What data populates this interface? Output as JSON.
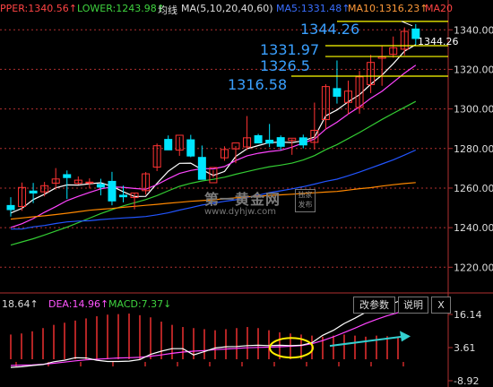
{
  "legend": {
    "upper": "PPER:1340.56↑",
    "lower": "LOWER:1243.98↑",
    "ma_label": "均线",
    "ma_periods": "MA(5,10,20,40,60)",
    "ma5": "MA5:1331.48↑",
    "ma10": "MA10:1316.23↑",
    "ma20": "MA20"
  },
  "macd_legend": {
    "dif": "18.64↑",
    "dea": "DEA:14.96↑",
    "macd": "MACD:7.37↓"
  },
  "controls": {
    "params_label": "改参数",
    "help_label": "说明",
    "close_label": "X"
  },
  "annotations": {
    "level1": "1344.26",
    "level2": "1331.97",
    "level3": "1326.5",
    "level4": "1316.58",
    "last_price": "1344.26"
  },
  "watermark": {
    "name": "第一黄金网",
    "url": "www.dyhjw.com",
    "stamp": "独家发布"
  },
  "axis": {
    "y_ticks": [
      "1340.00",
      "1320.00",
      "1300.00",
      "1280.00",
      "1260.00",
      "1240.00",
      "1220.00"
    ],
    "macd_ticks": [
      "16.14",
      "3.61",
      "-8.92"
    ]
  },
  "colors": {
    "up": "#ff3333",
    "down": "#00e5ff",
    "ma5": "#ffffff",
    "ma10": "#ff44ff",
    "ma20": "#33cc33",
    "ma40": "#2255ff",
    "ma60": "#ff8800",
    "level_line": "#ffff00",
    "annotation": "#3aa0ff",
    "grid": "#b03030"
  },
  "chart_data": [
    {
      "type": "candlestick",
      "ylim": [
        1207,
        1346
      ],
      "candles": [
        {
          "o": 1251.2,
          "h": 1255.4,
          "l": 1245.6,
          "c": 1249.1
        },
        {
          "o": 1250.7,
          "h": 1262.8,
          "l": 1248.5,
          "c": 1260.3
        },
        {
          "o": 1258.5,
          "h": 1262.6,
          "l": 1252.4,
          "c": 1257.5
        },
        {
          "o": 1258.1,
          "h": 1263.1,
          "l": 1255.8,
          "c": 1261.2
        },
        {
          "o": 1262.5,
          "h": 1270.1,
          "l": 1259.2,
          "c": 1264.6
        },
        {
          "o": 1266.8,
          "h": 1268.9,
          "l": 1254.5,
          "c": 1265.3
        },
        {
          "o": 1262.4,
          "h": 1265.9,
          "l": 1261.8,
          "c": 1264.0
        },
        {
          "o": 1262.6,
          "h": 1264.9,
          "l": 1259.8,
          "c": 1263.0
        },
        {
          "o": 1261.9,
          "h": 1264.7,
          "l": 1256.3,
          "c": 1260.5
        },
        {
          "o": 1263.4,
          "h": 1268.2,
          "l": 1251.3,
          "c": 1253.5
        },
        {
          "o": 1256.4,
          "h": 1261.2,
          "l": 1252.8,
          "c": 1255.6
        },
        {
          "o": 1255.2,
          "h": 1257.4,
          "l": 1249.3,
          "c": 1257.5
        },
        {
          "o": 1258.7,
          "h": 1268.1,
          "l": 1256.7,
          "c": 1267.2
        },
        {
          "o": 1270.6,
          "h": 1282.5,
          "l": 1268.6,
          "c": 1281.4
        },
        {
          "o": 1284.6,
          "h": 1286.6,
          "l": 1280.5,
          "c": 1279.3
        },
        {
          "o": 1279.2,
          "h": 1285.8,
          "l": 1276.3,
          "c": 1286.7
        },
        {
          "o": 1284.4,
          "h": 1286.9,
          "l": 1275.6,
          "c": 1276.2
        },
        {
          "o": 1275.5,
          "h": 1281.5,
          "l": 1265.2,
          "c": 1264.4
        },
        {
          "o": 1262.7,
          "h": 1269.1,
          "l": 1265.3,
          "c": 1270.4
        },
        {
          "o": 1275.3,
          "h": 1281.1,
          "l": 1273.8,
          "c": 1279.5
        },
        {
          "o": 1279.8,
          "h": 1281.2,
          "l": 1272.6,
          "c": 1282.8
        },
        {
          "o": 1280.8,
          "h": 1296.4,
          "l": 1279.2,
          "c": 1285.4
        },
        {
          "o": 1286.5,
          "h": 1287.4,
          "l": 1282.7,
          "c": 1282.8
        },
        {
          "o": 1284.2,
          "h": 1292.4,
          "l": 1280.7,
          "c": 1282.7
        },
        {
          "o": 1285.5,
          "h": 1286.6,
          "l": 1279.2,
          "c": 1281.1
        },
        {
          "o": 1284.1,
          "h": 1284.7,
          "l": 1276.8,
          "c": 1285.2
        },
        {
          "o": 1285.4,
          "h": 1287.0,
          "l": 1280.1,
          "c": 1281.8
        },
        {
          "o": 1283.1,
          "h": 1303.2,
          "l": 1279.5,
          "c": 1289.2
        },
        {
          "o": 1294.6,
          "h": 1312.5,
          "l": 1289.6,
          "c": 1311.3
        },
        {
          "o": 1310.3,
          "h": 1324.5,
          "l": 1302.7,
          "c": 1306.4
        },
        {
          "o": 1303.3,
          "h": 1314.3,
          "l": 1297.2,
          "c": 1309.0
        },
        {
          "o": 1300.8,
          "h": 1319.2,
          "l": 1297.6,
          "c": 1316.2
        },
        {
          "o": 1312.3,
          "h": 1327.3,
          "l": 1308.0,
          "c": 1323.5
        },
        {
          "o": 1325.6,
          "h": 1331.7,
          "l": 1311.7,
          "c": 1326.3
        },
        {
          "o": 1327.6,
          "h": 1336.6,
          "l": 1325.9,
          "c": 1330.9
        },
        {
          "o": 1330.2,
          "h": 1341.2,
          "l": 1327.1,
          "c": 1339.2
        },
        {
          "o": 1340.4,
          "h": 1342.9,
          "l": 1332.5,
          "c": 1335.6
        }
      ],
      "moving_averages": [
        {
          "name": "MA5",
          "values": [
            1247.4,
            1249.8,
            1254.2,
            1256.9,
            1260.1,
            1261.6,
            1261.5,
            1262.2,
            1262.7,
            1260.9,
            1258.1,
            1255.7,
            1255.8,
            1262.4,
            1268.5,
            1272.5,
            1272.6,
            1269.3,
            1266.4,
            1268.4,
            1276.0,
            1279.9,
            1281.5,
            1283.0,
            1283.2,
            1283.0,
            1283.9,
            1285.8,
            1296.5,
            1299.5,
            1303.6,
            1307.2,
            1312.5,
            1317.1,
            1322.8,
            1329.2,
            1332.5
          ]
        },
        {
          "name": "MA10",
          "values": [
            1240.1,
            1242.0,
            1244.6,
            1247.8,
            1250.6,
            1253.7,
            1255.8,
            1257.8,
            1259.6,
            1260.6,
            1260.4,
            1259.8,
            1259.4,
            1261.8,
            1264.7,
            1267.4,
            1268.9,
            1269.9,
            1269.7,
            1270.9,
            1273.9,
            1276.3,
            1277.6,
            1278.5,
            1279.1,
            1280.7,
            1282.8,
            1284.8,
            1289.8,
            1293.3,
            1297.4,
            1301.1,
            1305.4,
            1308.9,
            1313.5,
            1318.1,
            1322.1
          ]
        },
        {
          "name": "MA20",
          "values": [
            1231.2,
            1232.8,
            1234.4,
            1236.3,
            1238.3,
            1240.3,
            1242.5,
            1244.8,
            1247.1,
            1249.1,
            1251.0,
            1252.6,
            1254.2,
            1256.2,
            1258.6,
            1260.9,
            1262.4,
            1263.6,
            1264.4,
            1265.5,
            1267.0,
            1268.3,
            1269.6,
            1270.8,
            1271.6,
            1272.6,
            1274.2,
            1276.4,
            1279.4,
            1282.0,
            1285.0,
            1288.1,
            1291.4,
            1294.7,
            1297.8,
            1300.8,
            1303.8
          ]
        },
        {
          "name": "MA40",
          "values": [
            1239.3,
            1239.3,
            1240.4,
            1241.1,
            1242.1,
            1242.9,
            1243.3,
            1243.5,
            1244.1,
            1244.5,
            1244.9,
            1245.2,
            1245.6,
            1246.5,
            1247.5,
            1248.9,
            1250.1,
            1251.4,
            1252.3,
            1253.3,
            1254.1,
            1255.3,
            1256.4,
            1257.7,
            1258.6,
            1259.6,
            1260.7,
            1262.0,
            1263.4,
            1264.5,
            1266.2,
            1268.1,
            1270.1,
            1272.2,
            1274.3,
            1276.7,
            1279.2
          ]
        },
        {
          "name": "MA60",
          "values": [
            1244.3,
            1244.9,
            1245.5,
            1246.0,
            1246.6,
            1247.3,
            1248.0,
            1248.8,
            1249.3,
            1249.7,
            1250.3,
            1250.8,
            1251.3,
            1251.8,
            1252.3,
            1252.8,
            1253.3,
            1253.7,
            1254.1,
            1254.6,
            1255.1,
            1255.6,
            1255.9,
            1256.3,
            1256.6,
            1256.9,
            1257.3,
            1257.6,
            1258.0,
            1258.3,
            1259.0,
            1259.7,
            1260.2,
            1261.0,
            1261.7,
            1262.3,
            1262.8
          ]
        }
      ],
      "levels": [
        1344.26,
        1331.97,
        1326.5,
        1316.58
      ]
    },
    {
      "type": "macd",
      "ylim": [
        -8.92,
        16.14
      ],
      "dif": [
        -2.6,
        -2.4,
        -2.0,
        -1.7,
        -0.8,
        -0.3,
        0.5,
        0.4,
        -0.3,
        -0.7,
        -0.7,
        -0.6,
        -0.1,
        1.6,
        2.6,
        3.4,
        3.4,
        1.4,
        2.5,
        3.6,
        4.0,
        4.1,
        4.4,
        4.5,
        4.4,
        4.5,
        4.4,
        4.5,
        5.3,
        7.7,
        9.3,
        11.5,
        13.2,
        15.1,
        16.1,
        17.2,
        18.6
      ],
      "dea": [
        -2.0,
        -1.9,
        -1.8,
        -1.6,
        -1.3,
        -0.9,
        -0.5,
        -0.2,
        0.0,
        0.2,
        0.4,
        0.5,
        0.6,
        1.0,
        1.4,
        1.9,
        2.3,
        2.6,
        2.8,
        3.1,
        3.3,
        3.5,
        3.7,
        3.8,
        3.9,
        4.0,
        4.2,
        4.4,
        5.0,
        6.0,
        7.2,
        8.6,
        10.0,
        11.5,
        12.8,
        14.0,
        15.0
      ],
      "macd": [
        -0.6,
        -0.8,
        -1.2,
        -1.8,
        -2.4,
        -2.8,
        -3.2,
        -3.6,
        -4.0,
        -4.3,
        -4.4,
        -4.5,
        -4.2,
        -3.8,
        -3.0,
        -2.4,
        -2.0,
        -1.8,
        -1.6,
        -1.4,
        -1.6,
        -1.8,
        -2.0,
        -1.8,
        -1.4,
        -1.0,
        -0.8,
        -0.6,
        -0.4,
        -0.2,
        -0.4,
        -0.6,
        -0.4,
        -0.2,
        -0.4,
        -0.3,
        -0.2
      ],
      "trend_values": [
        4.3,
        7.4
      ],
      "highlight_value": 3.7
    }
  ]
}
